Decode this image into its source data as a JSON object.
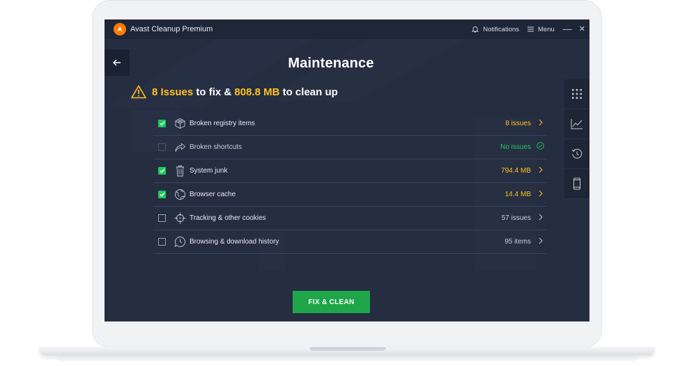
{
  "window": {
    "app_title": "Avast Cleanup Premium",
    "notifications_label": "Notifications",
    "menu_label": "Menu",
    "minimize_glyph": "—",
    "close_glyph": "✕"
  },
  "page": {
    "title": "Maintenance",
    "summary": {
      "issues": "8 Issues",
      "text_1": " to fix & ",
      "size": "808.8 MB",
      "text_2": " to clean up"
    }
  },
  "items": [
    {
      "label": "Broken registry items",
      "value": "8 issues",
      "checked": true,
      "value_color": "yellow",
      "icon": "cube-icon"
    },
    {
      "label": "Broken shortcuts",
      "value": "No issues",
      "checked": false,
      "value_color": "green",
      "icon": "shortcut-arrow-icon"
    },
    {
      "label": "System junk",
      "value": "794.4 MB",
      "checked": true,
      "value_color": "yellow",
      "icon": "trash-icon"
    },
    {
      "label": "Browser cache",
      "value": "14.4 MB",
      "checked": true,
      "value_color": "yellow",
      "icon": "globe-icon"
    },
    {
      "label": "Tracking & other cookies",
      "value": "57 issues",
      "checked": false,
      "value_color": "grey",
      "icon": "crosshair-icon"
    },
    {
      "label": "Browsing & download history",
      "value": "95 items",
      "checked": false,
      "value_color": "grey",
      "icon": "history-bubble-icon"
    }
  ],
  "action": {
    "fix_clean_label": "FIX & CLEAN"
  },
  "sidebar": [
    "grid-icon",
    "chart-icon",
    "history-icon",
    "phone-icon"
  ],
  "colors": {
    "accent_green": "#1fa64a",
    "highlight_yellow": "#ffc21c",
    "screen_bg": "#252d41",
    "avast_orange": "#ff7a00"
  }
}
